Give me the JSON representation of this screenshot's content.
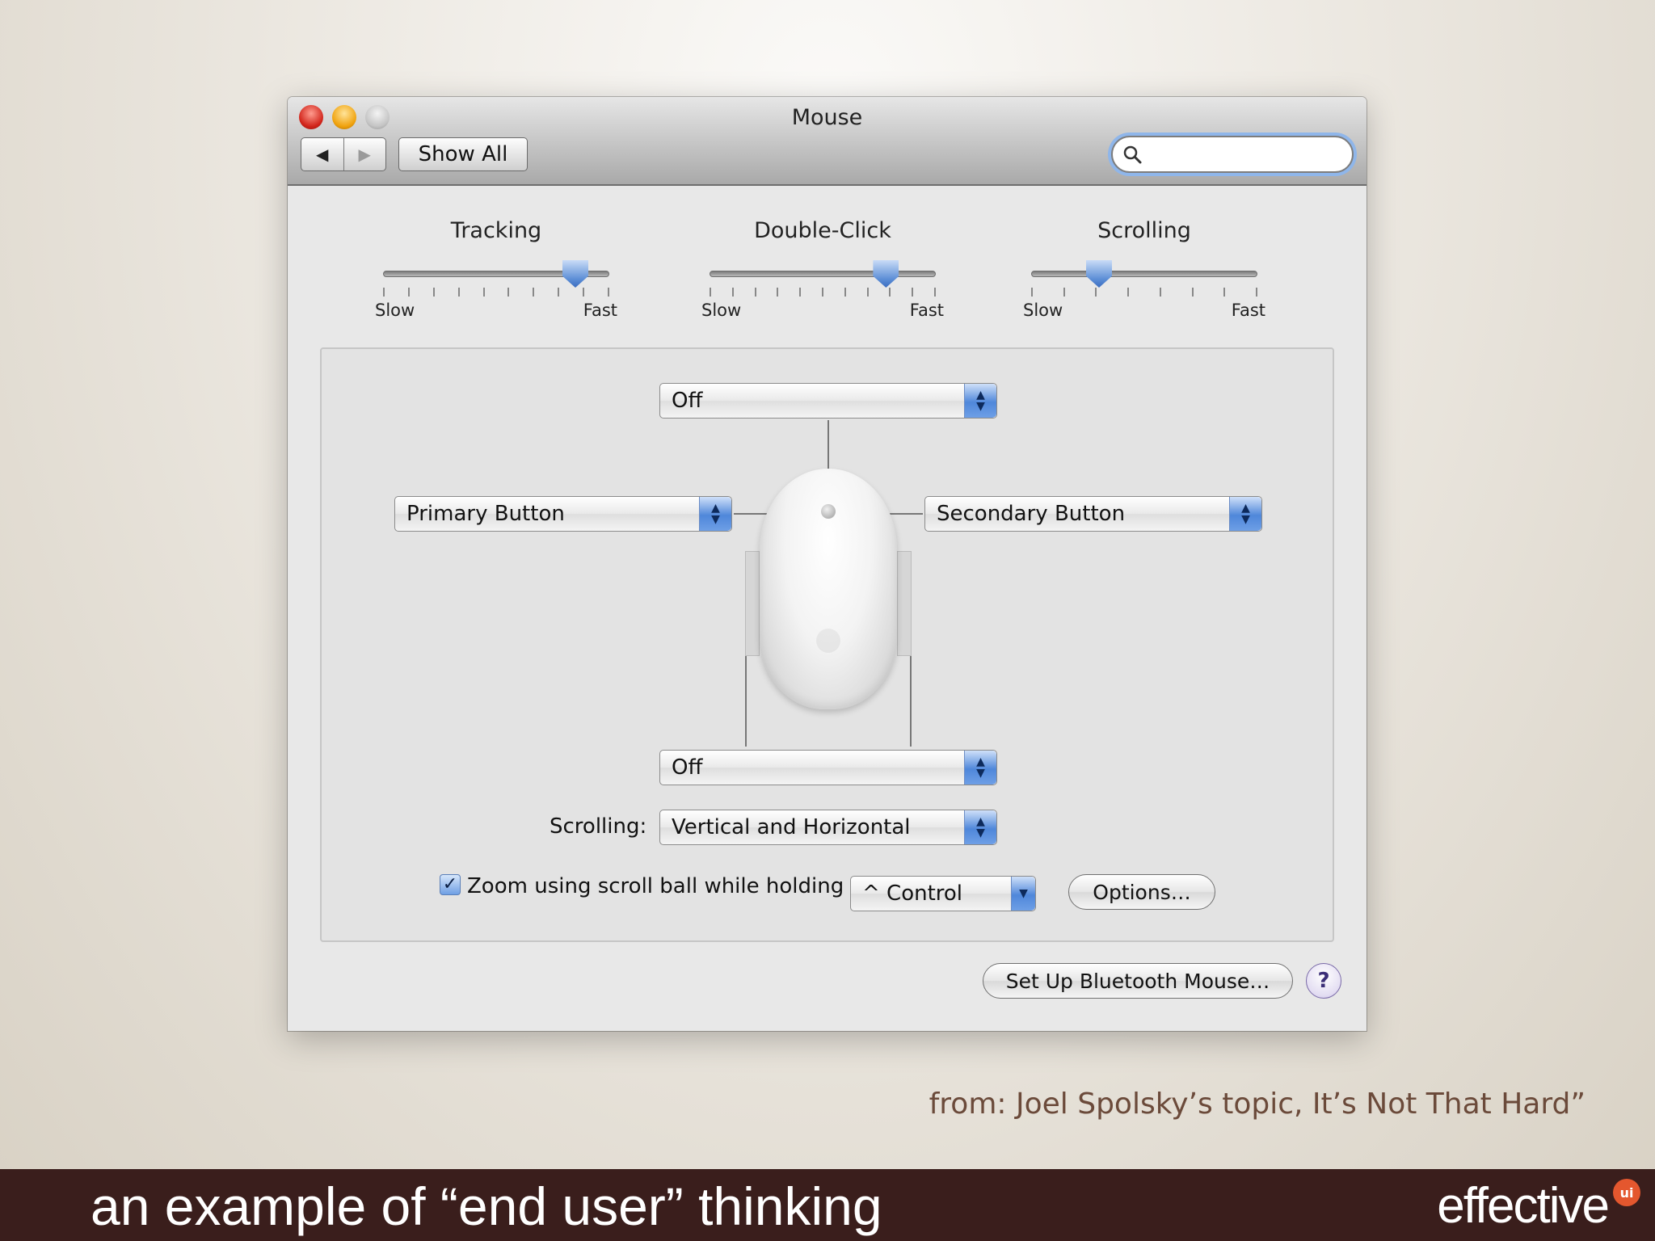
{
  "window": {
    "title": "Mouse",
    "toolbar": {
      "back_icon": "◀",
      "forward_icon": "▶",
      "show_all_label": "Show All"
    },
    "search": {
      "value": "",
      "placeholder": ""
    }
  },
  "sliders": [
    {
      "title": "Tracking",
      "min_label": "Slow",
      "max_label": "Fast",
      "ticks": 10,
      "value": 0.85
    },
    {
      "title": "Double-Click",
      "min_label": "Slow",
      "max_label": "Fast",
      "ticks": 11,
      "value": 0.78
    },
    {
      "title": "Scrolling",
      "min_label": "Slow",
      "max_label": "Fast",
      "ticks": 8,
      "value": 0.3
    }
  ],
  "buttons_panel": {
    "top_popup": "Off",
    "left_popup": "Primary Button",
    "right_popup": "Secondary Button",
    "bottom_popup": "Off",
    "scrolling_label": "Scrolling:",
    "scrolling_popup": "Vertical and Horizontal",
    "zoom_checked": true,
    "zoom_label": "Zoom using scroll ball while holding",
    "zoom_modifier": "^ Control",
    "options_button": "Options…"
  },
  "footer_buttons": {
    "bluetooth_button": "Set Up Bluetooth Mouse…",
    "help_label": "?"
  },
  "slide": {
    "caption": "from: Joel Spolsky’s topic, It’s Not That Hard”",
    "footer_text": "an example of “end user” thinking",
    "brand": "effective",
    "brand_badge": "ui"
  },
  "colors": {
    "footer_bar": "#3a1e1c",
    "caption_text": "#6b4a3a",
    "accent_blue": "#4f87da"
  }
}
